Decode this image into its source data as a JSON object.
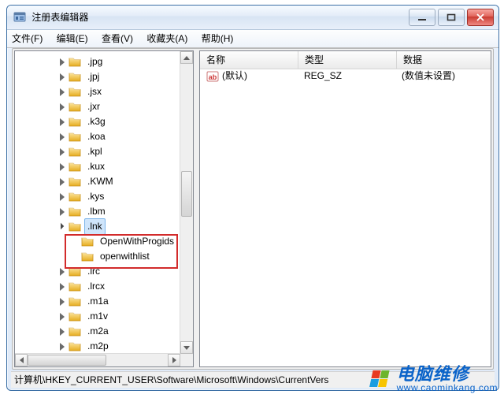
{
  "window": {
    "title": "注册表编辑器"
  },
  "menus": {
    "file": "文件(F)",
    "edit": "编辑(E)",
    "view": "查看(V)",
    "fav": "收藏夹(A)",
    "help": "帮助(H)"
  },
  "tree": [
    {
      "indent": 3,
      "state": "collapsed",
      "label": ".jpg"
    },
    {
      "indent": 3,
      "state": "collapsed",
      "label": ".jpj"
    },
    {
      "indent": 3,
      "state": "collapsed",
      "label": ".jsx"
    },
    {
      "indent": 3,
      "state": "collapsed",
      "label": ".jxr"
    },
    {
      "indent": 3,
      "state": "collapsed",
      "label": ".k3g"
    },
    {
      "indent": 3,
      "state": "collapsed",
      "label": ".koa"
    },
    {
      "indent": 3,
      "state": "collapsed",
      "label": ".kpl"
    },
    {
      "indent": 3,
      "state": "collapsed",
      "label": ".kux"
    },
    {
      "indent": 3,
      "state": "collapsed",
      "label": ".KWM"
    },
    {
      "indent": 3,
      "state": "collapsed",
      "label": ".kys"
    },
    {
      "indent": 3,
      "state": "collapsed",
      "label": ".lbm"
    },
    {
      "indent": 3,
      "state": "expanded",
      "label": ".lnk",
      "selected": true
    },
    {
      "indent": 4,
      "state": "none",
      "label": "OpenWithProgids",
      "highlight": true
    },
    {
      "indent": 4,
      "state": "none",
      "label": "openwithlist",
      "highlight": true
    },
    {
      "indent": 3,
      "state": "collapsed",
      "label": ".lrc"
    },
    {
      "indent": 3,
      "state": "collapsed",
      "label": ".lrcx"
    },
    {
      "indent": 3,
      "state": "collapsed",
      "label": ".m1a"
    },
    {
      "indent": 3,
      "state": "collapsed",
      "label": ".m1v"
    },
    {
      "indent": 3,
      "state": "collapsed",
      "label": ".m2a"
    },
    {
      "indent": 3,
      "state": "collapsed",
      "label": ".m2p"
    }
  ],
  "columns": {
    "name": "名称",
    "type": "类型",
    "data": "数据"
  },
  "rows": [
    {
      "name": "(默认)",
      "type": "REG_SZ",
      "data": "(数值未设置)"
    }
  ],
  "statusbar": "计算机\\HKEY_CURRENT_USER\\Software\\Microsoft\\Windows\\CurrentVers",
  "watermark": {
    "title": "电脑维修",
    "site": "www.caominkang.com"
  },
  "colors": {
    "folder_a": "#f8d56a",
    "folder_b": "#e7b327",
    "accent": "#0a63c9"
  }
}
